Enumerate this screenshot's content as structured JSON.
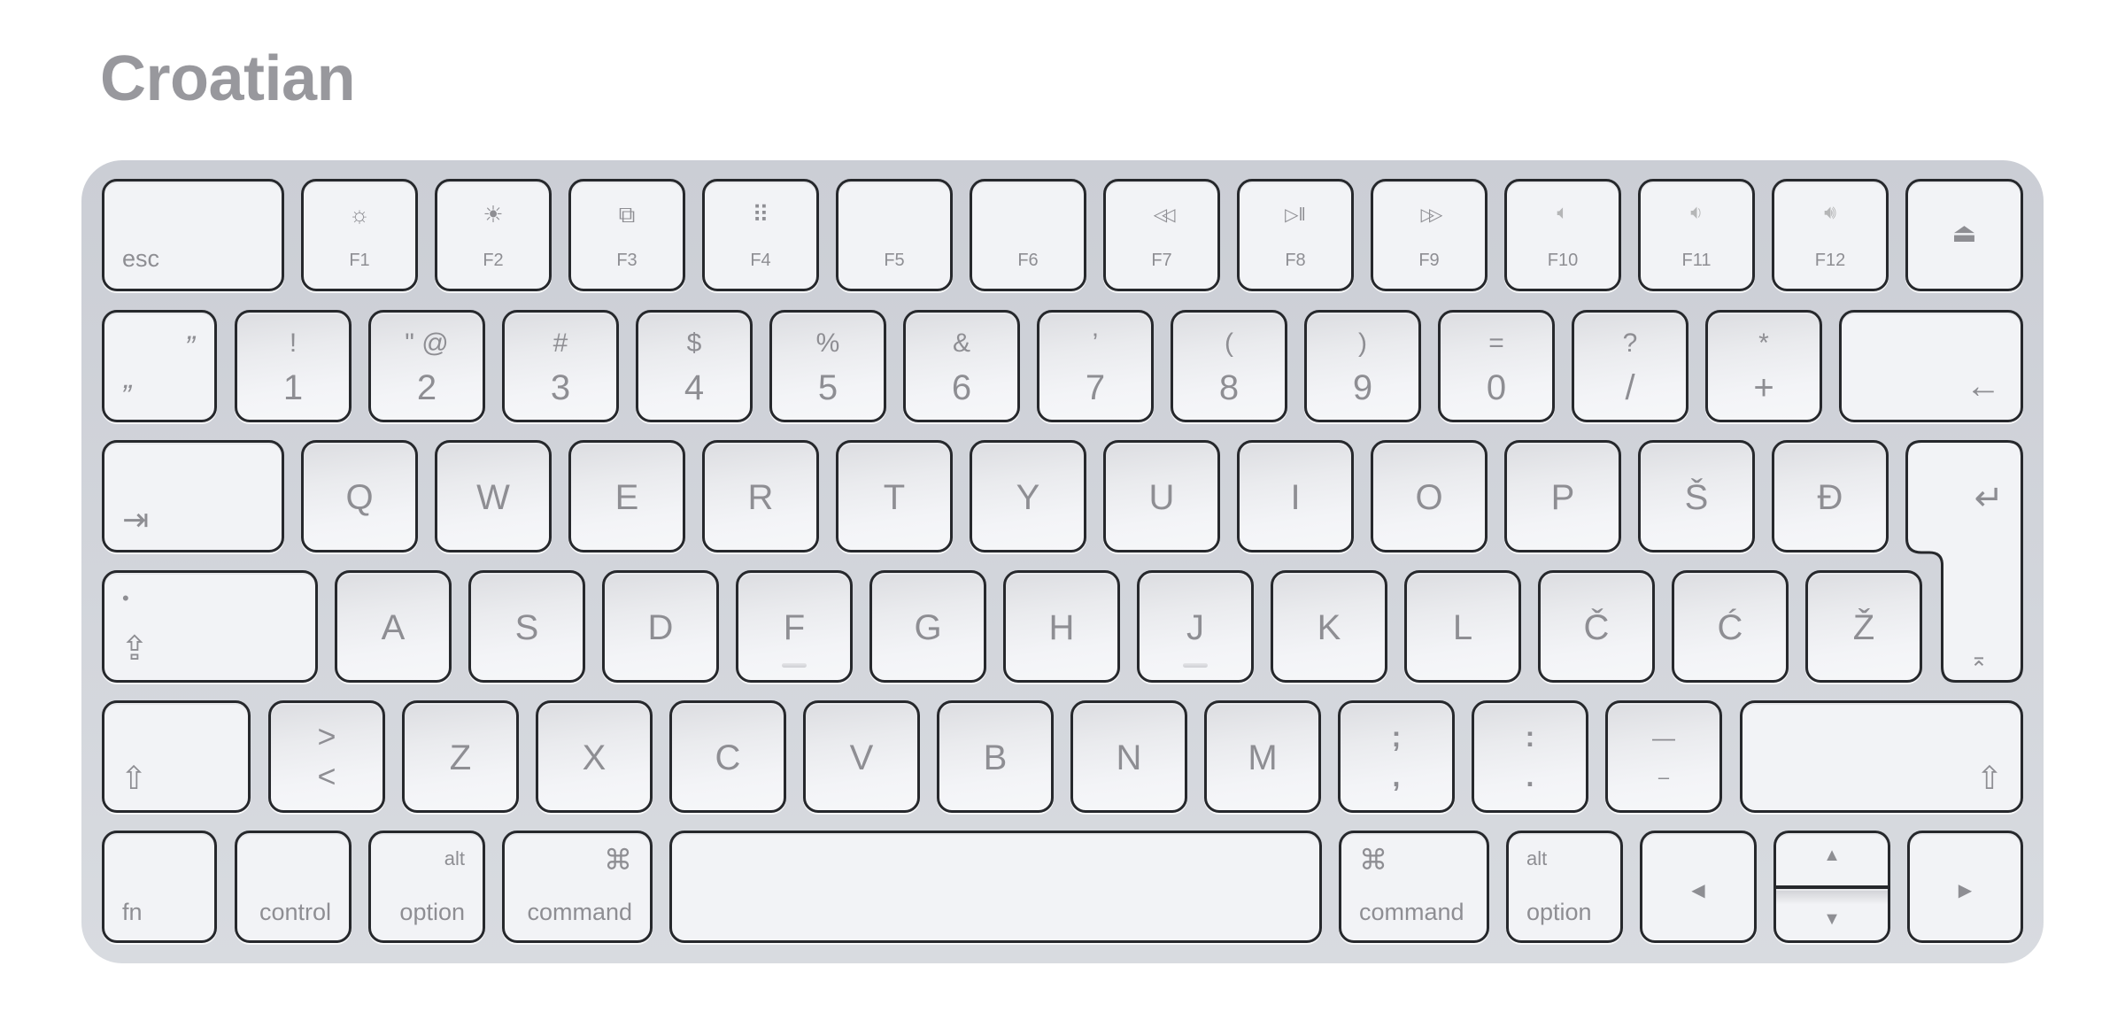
{
  "title": "Croatian",
  "colors": {
    "title": "#98989d",
    "keyboard_body": "#cbced5",
    "key_face": "#f2f3f6",
    "key_border": "#26282c",
    "legend": "#8e8e93"
  },
  "keyboard": {
    "row1": {
      "esc": "esc",
      "f_keys": [
        {
          "label": "F1",
          "icon": "brightness-down-icon",
          "glyph": "☼"
        },
        {
          "label": "F2",
          "icon": "brightness-up-icon",
          "glyph": "☀"
        },
        {
          "label": "F3",
          "icon": "mission-control-icon",
          "glyph": "⧉"
        },
        {
          "label": "F4",
          "icon": "launchpad-icon",
          "glyph": "⠿"
        },
        {
          "label": "F5",
          "icon": "",
          "glyph": ""
        },
        {
          "label": "F6",
          "icon": "",
          "glyph": ""
        },
        {
          "label": "F7",
          "icon": "rewind-icon",
          "glyph": "◁◁"
        },
        {
          "label": "F8",
          "icon": "play-pause-icon",
          "glyph": "▷‖"
        },
        {
          "label": "F9",
          "icon": "fast-forward-icon",
          "glyph": "▷▷"
        },
        {
          "label": "F10",
          "icon": "mute-icon",
          "glyph": "🔈︎"
        },
        {
          "label": "F11",
          "icon": "volume-down-icon",
          "glyph": "🔉︎"
        },
        {
          "label": "F12",
          "icon": "volume-up-icon",
          "glyph": "🔊︎"
        }
      ],
      "eject": "⏏"
    },
    "row2": {
      "backtick": {
        "top": "”",
        "bottom": "„"
      },
      "keys": [
        {
          "top": "!",
          "bottom": "1"
        },
        {
          "top": "\" @",
          "bottom": "2"
        },
        {
          "top": "#",
          "bottom": "3"
        },
        {
          "top": "$",
          "bottom": "4"
        },
        {
          "top": "%",
          "bottom": "5"
        },
        {
          "top": "&",
          "bottom": "6"
        },
        {
          "top": "’",
          "bottom": "7"
        },
        {
          "top": "(",
          "bottom": "8"
        },
        {
          "top": ")",
          "bottom": "9"
        },
        {
          "top": "=",
          "bottom": "0"
        },
        {
          "top": "?",
          "bottom": "/"
        },
        {
          "top": "*",
          "bottom": "+"
        }
      ],
      "backspace": "←"
    },
    "row3": {
      "tab": "⇥",
      "keys": [
        "Q",
        "W",
        "E",
        "R",
        "T",
        "Y",
        "U",
        "I",
        "O",
        "P",
        "Š",
        "Đ"
      ],
      "return": "↵",
      "return_alt": "⌅"
    },
    "row4": {
      "caps_dot": "•",
      "caps": "⇪",
      "keys": [
        "A",
        "S",
        "D",
        "F",
        "G",
        "H",
        "J",
        "K",
        "L",
        "Č",
        "Ć",
        "Ž"
      ]
    },
    "row5": {
      "shift": "⇧",
      "angle": {
        "top": ">",
        "bottom": "<"
      },
      "keys": [
        "Z",
        "X",
        "C",
        "V",
        "B",
        "N",
        "M"
      ],
      "punct": [
        {
          "top": ";",
          "bottom": ","
        },
        {
          "top": ":",
          "bottom": "."
        },
        {
          "top": "—",
          "bottom": "–"
        }
      ],
      "right_shift": "⇧"
    },
    "row6": {
      "fn": "fn",
      "control": "control",
      "option_left": {
        "top": "alt",
        "bottom": "option"
      },
      "command_left": {
        "top": "⌘",
        "bottom": "command"
      },
      "command_right": {
        "top": "⌘",
        "bottom": "command"
      },
      "option_right": {
        "top": "alt",
        "bottom": "option"
      },
      "arrow_left": "◀",
      "arrow_up": "▲",
      "arrow_down": "▼",
      "arrow_right": "▶"
    }
  }
}
